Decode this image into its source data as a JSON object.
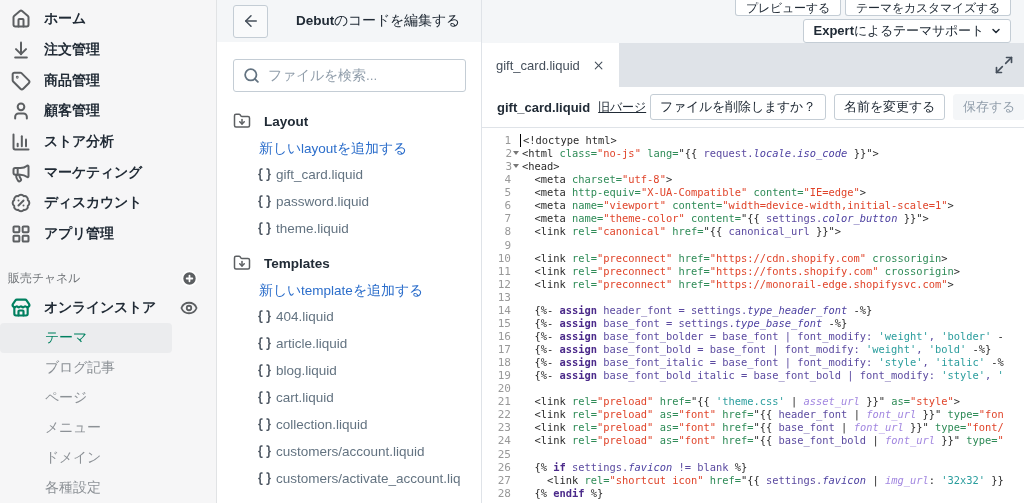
{
  "sidebar": {
    "items": [
      {
        "label": "ホーム"
      },
      {
        "label": "注文管理"
      },
      {
        "label": "商品管理"
      },
      {
        "label": "顧客管理"
      },
      {
        "label": "ストア分析"
      },
      {
        "label": "マーケティング"
      },
      {
        "label": "ディスカウント"
      },
      {
        "label": "アプリ管理"
      }
    ],
    "channels_heading": "販売チャネル",
    "channel": {
      "label": "オンラインストア",
      "children": [
        {
          "label": "テーマ",
          "selected": true
        },
        {
          "label": "ブログ記事",
          "selected": false
        },
        {
          "label": "ページ",
          "selected": false
        },
        {
          "label": "メニュー",
          "selected": false
        },
        {
          "label": "ドメイン",
          "selected": false
        },
        {
          "label": "各種設定",
          "selected": false
        }
      ]
    }
  },
  "file_panel": {
    "title": "**Debut**のコードを編集する",
    "search": {
      "placeholder": "ファイルを検索..."
    },
    "sections": [
      {
        "name": "Layout",
        "add_link": "新しいlayoutを追加する",
        "files": [
          "gift_card.liquid",
          "password.liquid",
          "theme.liquid"
        ]
      },
      {
        "name": "Templates",
        "add_link": "新しいtemplateを追加する",
        "files": [
          "404.liquid",
          "article.liquid",
          "blog.liquid",
          "cart.liquid",
          "collection.liquid",
          "customers/account.liquid",
          "customers/activate_account.liq"
        ]
      }
    ]
  },
  "header_buttons": [
    "プレビューする",
    "テーマをカスタマイズする"
  ],
  "support_button": "**Expert**によるテーマサポート",
  "tabs": [
    {
      "label": "gift_card.liquid",
      "selected": true
    }
  ],
  "file_toolbar": {
    "filename": "gift_card.liquid",
    "old_versions_link": "旧バージ",
    "buttons": [
      {
        "label": "ファイルを削除しますか？",
        "disabled": false
      },
      {
        "label": "名前を変更する",
        "disabled": false
      },
      {
        "label": "保存する",
        "disabled": true
      }
    ]
  },
  "code": [
    {
      "n": "1",
      "fold": false,
      "tokens": [
        {
          "kind": "tag",
          "text": "<!doctype html>"
        }
      ]
    },
    {
      "n": "2",
      "fold": true,
      "tokens": [
        {
          "kind": "tag",
          "text": "<html "
        },
        {
          "kind": "attr",
          "text": "class="
        },
        {
          "kind": "str",
          "text": "\"no-js\""
        },
        {
          "kind": "attr",
          "text": " lang="
        },
        {
          "kind": "plain",
          "text": "\"{{ "
        },
        {
          "kind": "var",
          "text": "request."
        },
        {
          "kind": "ital",
          "text": "locale"
        },
        {
          "kind": "var",
          "text": "."
        },
        {
          "kind": "ital",
          "text": "iso_code"
        },
        {
          "kind": "plain",
          "text": " }}\">"
        }
      ]
    },
    {
      "n": "3",
      "fold": true,
      "tokens": [
        {
          "kind": "tag",
          "text": "<head>"
        }
      ]
    },
    {
      "n": "4",
      "fold": false,
      "tokens": [
        {
          "kind": "tag",
          "text": "  <meta "
        },
        {
          "kind": "attr",
          "text": "charset="
        },
        {
          "kind": "str",
          "text": "\"utf-8\""
        },
        {
          "kind": "tag",
          "text": ">"
        }
      ]
    },
    {
      "n": "5",
      "fold": false,
      "tokens": [
        {
          "kind": "tag",
          "text": "  <meta "
        },
        {
          "kind": "attr",
          "text": "http-equiv="
        },
        {
          "kind": "str",
          "text": "\"X-UA-Compatible\""
        },
        {
          "kind": "attr",
          "text": " content="
        },
        {
          "kind": "str",
          "text": "\"IE=edge\""
        },
        {
          "kind": "tag",
          "text": ">"
        }
      ]
    },
    {
      "n": "6",
      "fold": false,
      "tokens": [
        {
          "kind": "tag",
          "text": "  <meta "
        },
        {
          "kind": "attr",
          "text": "name="
        },
        {
          "kind": "str",
          "text": "\"viewport\""
        },
        {
          "kind": "attr",
          "text": " content="
        },
        {
          "kind": "str",
          "text": "\"width=device-width,initial-scale=1\""
        },
        {
          "kind": "tag",
          "text": ">"
        }
      ]
    },
    {
      "n": "7",
      "fold": false,
      "tokens": [
        {
          "kind": "tag",
          "text": "  <meta "
        },
        {
          "kind": "attr",
          "text": "name="
        },
        {
          "kind": "str",
          "text": "\"theme-color\""
        },
        {
          "kind": "attr",
          "text": " content="
        },
        {
          "kind": "plain",
          "text": "\"{{ "
        },
        {
          "kind": "var",
          "text": "settings."
        },
        {
          "kind": "ital",
          "text": "color_button"
        },
        {
          "kind": "plain",
          "text": " }}\">"
        }
      ]
    },
    {
      "n": "8",
      "fold": false,
      "tokens": [
        {
          "kind": "tag",
          "text": "  <link "
        },
        {
          "kind": "attr",
          "text": "rel="
        },
        {
          "kind": "str",
          "text": "\"canonical\""
        },
        {
          "kind": "attr",
          "text": " href="
        },
        {
          "kind": "plain",
          "text": "\"{{ "
        },
        {
          "kind": "var",
          "text": "canonical_url"
        },
        {
          "kind": "plain",
          "text": " }}\">"
        }
      ]
    },
    {
      "n": "9",
      "fold": false
    },
    {
      "n": "10",
      "fold": false,
      "tokens": [
        {
          "kind": "tag",
          "text": "  <link "
        },
        {
          "kind": "attr",
          "text": "rel="
        },
        {
          "kind": "str",
          "text": "\"preconnect\""
        },
        {
          "kind": "attr",
          "text": " href="
        },
        {
          "kind": "str",
          "text": "\"https://cdn.shopify.com\""
        },
        {
          "kind": "attr",
          "text": " crossorigin"
        },
        {
          "kind": "tag",
          "text": ">"
        }
      ]
    },
    {
      "n": "11",
      "fold": false,
      "tokens": [
        {
          "kind": "tag",
          "text": "  <link "
        },
        {
          "kind": "attr",
          "text": "rel="
        },
        {
          "kind": "str",
          "text": "\"preconnect\""
        },
        {
          "kind": "attr",
          "text": " href="
        },
        {
          "kind": "str",
          "text": "\"https://fonts.shopify.com\""
        },
        {
          "kind": "attr",
          "text": " crossorigin"
        },
        {
          "kind": "tag",
          "text": ">"
        }
      ]
    },
    {
      "n": "12",
      "fold": false,
      "tokens": [
        {
          "kind": "tag",
          "text": "  <link "
        },
        {
          "kind": "attr",
          "text": "rel="
        },
        {
          "kind": "str",
          "text": "\"preconnect\""
        },
        {
          "kind": "attr",
          "text": " href="
        },
        {
          "kind": "str",
          "text": "\"https://monorail-edge.shopifysvc.com\""
        },
        {
          "kind": "tag",
          "text": ">"
        }
      ]
    },
    {
      "n": "13",
      "fold": false
    },
    {
      "n": "14",
      "fold": false,
      "tokens": [
        {
          "kind": "plain",
          "text": "  {%- "
        },
        {
          "kind": "kw",
          "text": "assign"
        },
        {
          "kind": "var",
          "text": " header_font = settings."
        },
        {
          "kind": "ital",
          "text": "type_header_font"
        },
        {
          "kind": "plain",
          "text": " -%}"
        }
      ]
    },
    {
      "n": "15",
      "fold": false,
      "tokens": [
        {
          "kind": "plain",
          "text": "  {%- "
        },
        {
          "kind": "kw",
          "text": "assign"
        },
        {
          "kind": "var",
          "text": " base_font = settings."
        },
        {
          "kind": "ital",
          "text": "type_base_font"
        },
        {
          "kind": "plain",
          "text": " -%}"
        }
      ]
    },
    {
      "n": "16",
      "fold": false,
      "tokens": [
        {
          "kind": "plain",
          "text": "  {%- "
        },
        {
          "kind": "kw",
          "text": "assign"
        },
        {
          "kind": "var",
          "text": " base_font_bolder = base_font | font_modify: "
        },
        {
          "kind": "lstr",
          "text": "'weight'"
        },
        {
          "kind": "var",
          "text": ", "
        },
        {
          "kind": "lstr",
          "text": "'bolder'"
        },
        {
          "kind": "plain",
          "text": " -"
        }
      ]
    },
    {
      "n": "17",
      "fold": false,
      "tokens": [
        {
          "kind": "plain",
          "text": "  {%- "
        },
        {
          "kind": "kw",
          "text": "assign"
        },
        {
          "kind": "var",
          "text": " base_font_bold = base_font | font_modify: "
        },
        {
          "kind": "lstr",
          "text": "'weight'"
        },
        {
          "kind": "var",
          "text": ", "
        },
        {
          "kind": "lstr",
          "text": "'bold'"
        },
        {
          "kind": "plain",
          "text": " -%}"
        }
      ]
    },
    {
      "n": "18",
      "fold": false,
      "tokens": [
        {
          "kind": "plain",
          "text": "  {%- "
        },
        {
          "kind": "kw",
          "text": "assign"
        },
        {
          "kind": "var",
          "text": " base_font_italic = base_font | font_modify: "
        },
        {
          "kind": "lstr",
          "text": "'style'"
        },
        {
          "kind": "var",
          "text": ", "
        },
        {
          "kind": "lstr",
          "text": "'italic'"
        },
        {
          "kind": "plain",
          "text": " -%"
        }
      ]
    },
    {
      "n": "19",
      "fold": false,
      "tokens": [
        {
          "kind": "plain",
          "text": "  {%- "
        },
        {
          "kind": "kw",
          "text": "assign"
        },
        {
          "kind": "var",
          "text": " base_font_bold_italic = base_font_bold | font_modify: "
        },
        {
          "kind": "lstr",
          "text": "'style'"
        },
        {
          "kind": "var",
          "text": ", "
        },
        {
          "kind": "lstr",
          "text": "'"
        }
      ]
    },
    {
      "n": "20",
      "fold": false
    },
    {
      "n": "21",
      "fold": false,
      "tokens": [
        {
          "kind": "tag",
          "text": "  <link "
        },
        {
          "kind": "attr",
          "text": "rel="
        },
        {
          "kind": "str",
          "text": "\"preload\""
        },
        {
          "kind": "attr",
          "text": " href="
        },
        {
          "kind": "plain",
          "text": "\"{{ "
        },
        {
          "kind": "lstr",
          "text": "'theme.css'"
        },
        {
          "kind": "plain",
          "text": " | "
        },
        {
          "kind": "filt",
          "text": "asset_url"
        },
        {
          "kind": "plain",
          "text": " }}\""
        },
        {
          "kind": "attr",
          "text": " as="
        },
        {
          "kind": "str",
          "text": "\"style\""
        },
        {
          "kind": "tag",
          "text": ">"
        }
      ]
    },
    {
      "n": "22",
      "fold": false,
      "tokens": [
        {
          "kind": "tag",
          "text": "  <link "
        },
        {
          "kind": "attr",
          "text": "rel="
        },
        {
          "kind": "str",
          "text": "\"preload\""
        },
        {
          "kind": "attr",
          "text": " as="
        },
        {
          "kind": "str",
          "text": "\"font\""
        },
        {
          "kind": "attr",
          "text": " href="
        },
        {
          "kind": "plain",
          "text": "\"{{ "
        },
        {
          "kind": "var",
          "text": "header_font"
        },
        {
          "kind": "plain",
          "text": " | "
        },
        {
          "kind": "filt",
          "text": "font_url"
        },
        {
          "kind": "plain",
          "text": " }}\""
        },
        {
          "kind": "attr",
          "text": " type="
        },
        {
          "kind": "str",
          "text": "\"fon"
        }
      ]
    },
    {
      "n": "23",
      "fold": false,
      "tokens": [
        {
          "kind": "tag",
          "text": "  <link "
        },
        {
          "kind": "attr",
          "text": "rel="
        },
        {
          "kind": "str",
          "text": "\"preload\""
        },
        {
          "kind": "attr",
          "text": " as="
        },
        {
          "kind": "str",
          "text": "\"font\""
        },
        {
          "kind": "attr",
          "text": " href="
        },
        {
          "kind": "plain",
          "text": "\"{{ "
        },
        {
          "kind": "var",
          "text": "base_font"
        },
        {
          "kind": "plain",
          "text": " | "
        },
        {
          "kind": "filt",
          "text": "font_url"
        },
        {
          "kind": "plain",
          "text": " }}\""
        },
        {
          "kind": "attr",
          "text": " type="
        },
        {
          "kind": "str",
          "text": "\"font/"
        }
      ]
    },
    {
      "n": "24",
      "fold": false,
      "tokens": [
        {
          "kind": "tag",
          "text": "  <link "
        },
        {
          "kind": "attr",
          "text": "rel="
        },
        {
          "kind": "str",
          "text": "\"preload\""
        },
        {
          "kind": "attr",
          "text": " as="
        },
        {
          "kind": "str",
          "text": "\"font\""
        },
        {
          "kind": "attr",
          "text": " href="
        },
        {
          "kind": "plain",
          "text": "\"{{ "
        },
        {
          "kind": "var",
          "text": "base_font_bold"
        },
        {
          "kind": "plain",
          "text": " | "
        },
        {
          "kind": "filt",
          "text": "font_url"
        },
        {
          "kind": "plain",
          "text": " }}\""
        },
        {
          "kind": "attr",
          "text": " type="
        },
        {
          "kind": "str",
          "text": "\""
        }
      ]
    },
    {
      "n": "25",
      "fold": false
    },
    {
      "n": "26",
      "fold": false,
      "tokens": [
        {
          "kind": "plain",
          "text": "  {% "
        },
        {
          "kind": "kw",
          "text": "if"
        },
        {
          "kind": "var",
          "text": " settings."
        },
        {
          "kind": "ital",
          "text": "favicon"
        },
        {
          "kind": "var",
          "text": " != blank"
        },
        {
          "kind": "plain",
          "text": " %}"
        }
      ]
    },
    {
      "n": "27",
      "fold": false,
      "tokens": [
        {
          "kind": "tag",
          "text": "    <link "
        },
        {
          "kind": "attr",
          "text": "rel="
        },
        {
          "kind": "str",
          "text": "\"shortcut icon\""
        },
        {
          "kind": "attr",
          "text": " href="
        },
        {
          "kind": "plain",
          "text": "\"{{ "
        },
        {
          "kind": "var",
          "text": "settings."
        },
        {
          "kind": "ital",
          "text": "favicon"
        },
        {
          "kind": "plain",
          "text": " | "
        },
        {
          "kind": "filt",
          "text": "img_url"
        },
        {
          "kind": "plain",
          "text": ": "
        },
        {
          "kind": "lstr",
          "text": "'32x32'"
        },
        {
          "kind": "plain",
          "text": " }}"
        }
      ]
    },
    {
      "n": "28",
      "fold": false,
      "tokens": [
        {
          "kind": "plain",
          "text": "  {% "
        },
        {
          "kind": "kw",
          "text": "endif"
        },
        {
          "kind": "plain",
          "text": " %}"
        }
      ]
    }
  ]
}
